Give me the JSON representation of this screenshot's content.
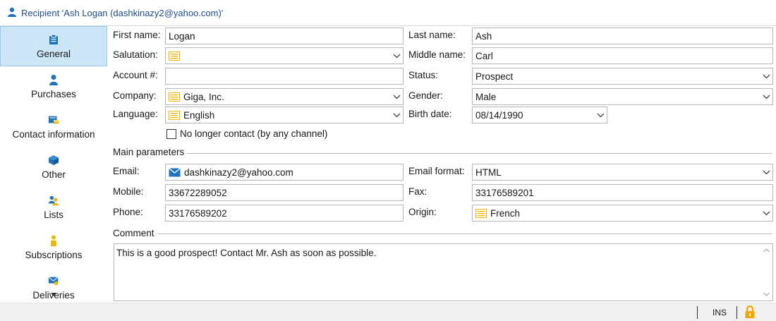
{
  "window": {
    "title": "Recipient 'Ash Logan (dashkinazy2@yahoo.com)'"
  },
  "sidebar": {
    "items": [
      {
        "label": "General",
        "icon": "general-icon",
        "active": true
      },
      {
        "label": "Purchases",
        "icon": "person-icon"
      },
      {
        "label": "Contact information",
        "icon": "contact-card-icon"
      },
      {
        "label": "Other",
        "icon": "cube-icon"
      },
      {
        "label": "Lists",
        "icon": "lists-icon"
      },
      {
        "label": "Subscriptions",
        "icon": "subscription-person-icon"
      },
      {
        "label": "Deliveries",
        "icon": "delivery-envelope-icon"
      }
    ]
  },
  "form": {
    "first_name": {
      "label": "First name:",
      "value": "Logan"
    },
    "last_name": {
      "label": "Last name:",
      "value": "Ash"
    },
    "salutation": {
      "label": "Salutation:",
      "value": ""
    },
    "middle_name": {
      "label": "Middle name:",
      "value": "Carl"
    },
    "account": {
      "label": "Account #:",
      "value": ""
    },
    "status": {
      "label": "Status:",
      "value": "Prospect"
    },
    "company": {
      "label": "Company:",
      "value": "Giga, Inc."
    },
    "gender": {
      "label": "Gender:",
      "value": "Male"
    },
    "language": {
      "label": "Language:",
      "value": "English"
    },
    "birth_date": {
      "label": "Birth date:",
      "value": "08/14/1990"
    },
    "no_longer_contact": {
      "label": "No longer contact (by any channel)",
      "checked": false
    }
  },
  "main_parameters": {
    "section_label": "Main parameters",
    "email": {
      "label": "Email:",
      "value": "dashkinazy2@yahoo.com"
    },
    "email_format": {
      "label": "Email format:",
      "value": "HTML"
    },
    "mobile": {
      "label": "Mobile:",
      "value": "33672289052"
    },
    "fax": {
      "label": "Fax:",
      "value": "33176589201"
    },
    "phone": {
      "label": "Phone:",
      "value": "33176589202"
    },
    "origin": {
      "label": "Origin:",
      "value": "French"
    }
  },
  "comment": {
    "section_label": "Comment",
    "value": "This is a good prospect! Contact Mr. Ash as soon as possible."
  },
  "statusbar": {
    "mode": "INS"
  },
  "colors": {
    "accent": "#1f4e8c",
    "selected_bg": "#cde6f7",
    "icon_blue": "#1e73be",
    "enum_yellow": "#f2b600"
  }
}
